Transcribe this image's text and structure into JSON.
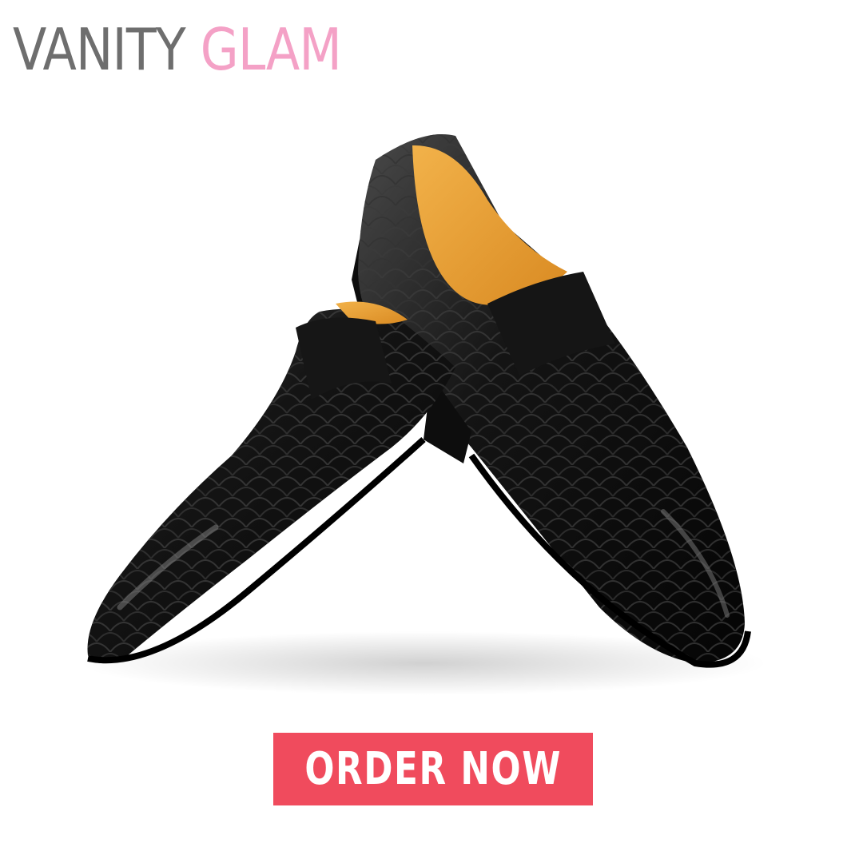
{
  "brand": {
    "word_1": "VANITY",
    "word_2": "GLAM",
    "word_1_color": "#6e6e6e",
    "word_2_color": "#f4a1c6"
  },
  "product": {
    "icon": "loafer-shoes-image",
    "leather_color": "#101010",
    "lining_color": "#e8a23a"
  },
  "cta": {
    "label": "ORDER NOW",
    "background_color": "#f04b5d"
  }
}
